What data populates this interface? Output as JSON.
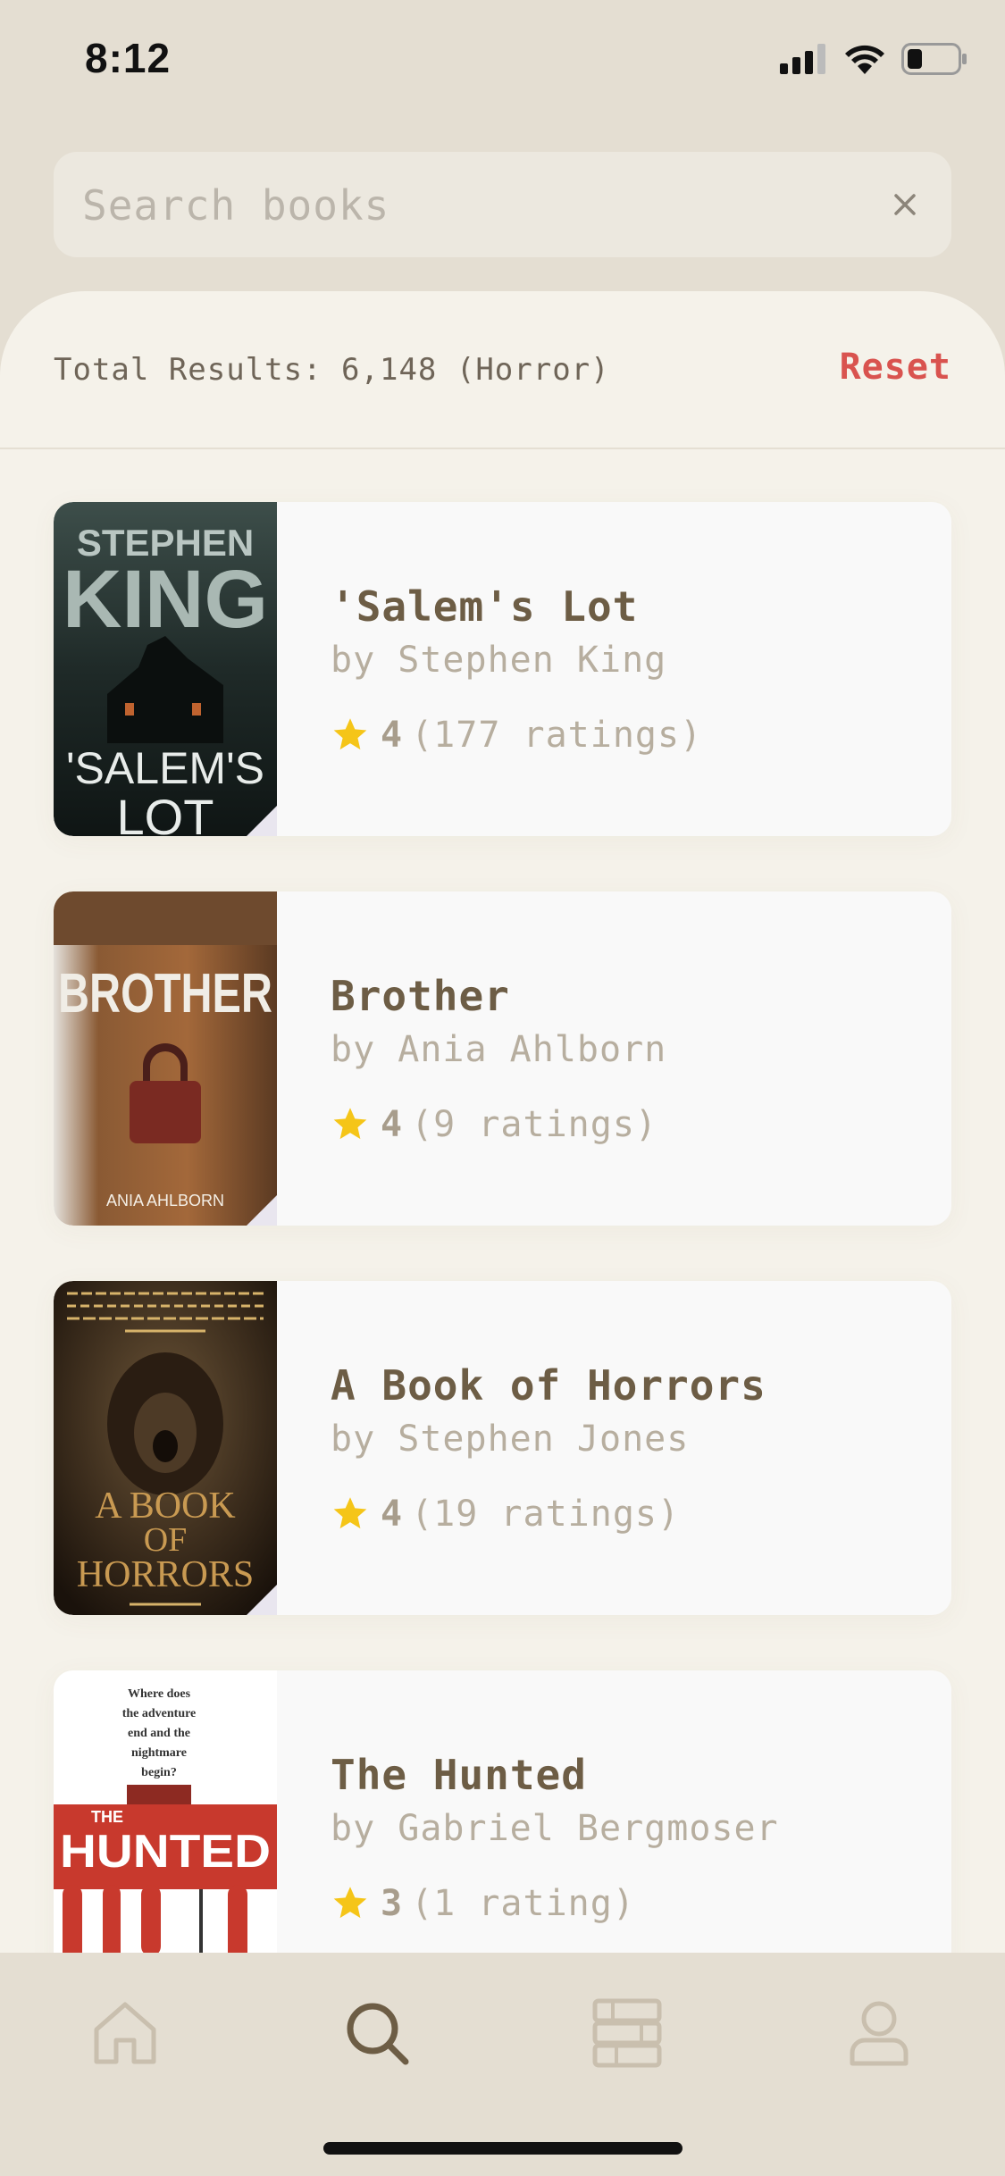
{
  "status_bar": {
    "time": "8:12"
  },
  "search": {
    "placeholder": "Search books",
    "value": ""
  },
  "results": {
    "summary": "Total Results: 6,148 (Horror)",
    "reset_label": "Reset"
  },
  "books": [
    {
      "title": "'Salem's Lot",
      "author": "by Stephen King",
      "rating": "4",
      "ratings_count": "(177 ratings)",
      "cover_lines": [
        "STEPHEN",
        "KING",
        "'SALEM'S",
        "LOT"
      ]
    },
    {
      "title": "Brother",
      "author": "by Ania Ahlborn",
      "rating": "4",
      "ratings_count": "(9 ratings)",
      "cover_lines": [
        "BROTHER",
        "ANIA AHLBORN"
      ]
    },
    {
      "title": "A Book of Horrors",
      "author": "by Stephen Jones",
      "rating": "4",
      "ratings_count": "(19 ratings)",
      "cover_lines": [
        "A BOOK",
        "OF",
        "HORRORS"
      ]
    },
    {
      "title": "The Hunted",
      "author": "by Gabriel Bergmoser",
      "rating": "3",
      "ratings_count": "(1 rating)",
      "cover_lines": [
        "Where does",
        "the adventure",
        "end and the",
        "nightmare",
        "begin?",
        "THE",
        "HUNTED"
      ]
    }
  ],
  "tab_bar": {
    "tabs": [
      {
        "icon": "home-icon",
        "active": false
      },
      {
        "icon": "search-icon",
        "active": true
      },
      {
        "icon": "library-icon",
        "active": false
      },
      {
        "icon": "profile-icon",
        "active": false
      }
    ]
  },
  "colors": {
    "background": "#e4ded2",
    "sheet": "#f5f2ea",
    "card": "#f9f9f9",
    "title": "#6d5d45",
    "muted": "#b7ae9f",
    "accent_red": "#d9534f",
    "star": "#f5c518",
    "tab_active": "#6d5d45",
    "tab_inactive": "#c9bfae"
  }
}
